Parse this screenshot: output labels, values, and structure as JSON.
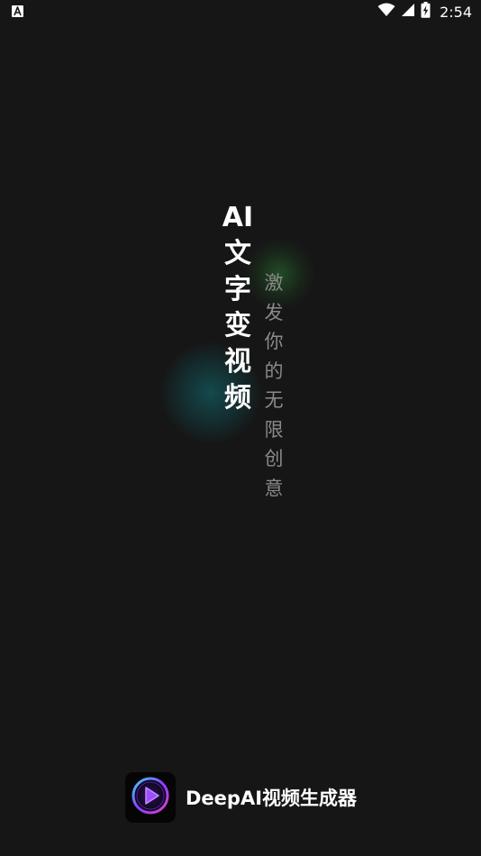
{
  "status_bar": {
    "time": "2:54",
    "left_icon": "notification-a-icon",
    "icons": [
      "wifi-icon",
      "signal-icon",
      "battery-charging-icon"
    ]
  },
  "splash": {
    "title": "AI文字变视频",
    "title_chars": [
      "AI",
      "文",
      "字",
      "变",
      "视",
      "频"
    ],
    "subtitle": "激发你的无限创意",
    "subtitle_chars": [
      "激",
      "发",
      "你",
      "的",
      "无",
      "限",
      "创",
      "意"
    ]
  },
  "brand": {
    "app_name": "DeepAI视频生成器",
    "icon": "play-logo-icon"
  },
  "colors": {
    "background": "#161616",
    "title": "#ffffff",
    "subtitle": "#8a8a8a",
    "glow_green": "#2e7834",
    "glow_teal": "#145256",
    "logo_purple": "#8a3cff",
    "logo_cyan": "#38d7ff"
  }
}
